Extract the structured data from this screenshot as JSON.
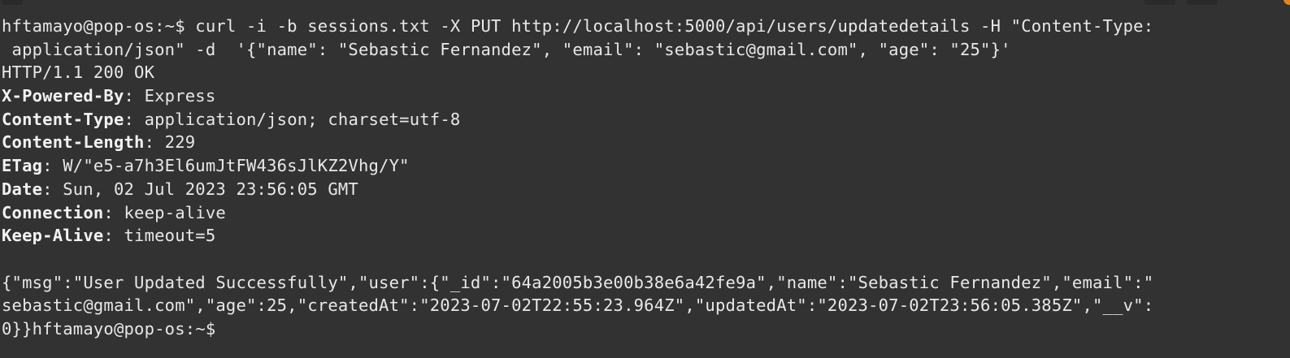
{
  "terminal": {
    "prompt": "hftamayo@pop-os:~$",
    "command_line_1": " curl -i -b sessions.txt -X PUT http://localhost:5000/api/users/updatedetails -H \"Content-Type:",
    "command_line_2": " application/json\" -d  '{\"name\": \"Sebastic Fernandez\", \"email\": \"sebastic@gmail.com\", \"age\": \"25\"}'",
    "status_line": "HTTP/1.1 200 OK",
    "headers": [
      {
        "name": "X-Powered-By",
        "value": ": Express"
      },
      {
        "name": "Content-Type",
        "value": ": application/json; charset=utf-8"
      },
      {
        "name": "Content-Length",
        "value": ": 229"
      },
      {
        "name": "ETag",
        "value": ": W/\"e5-a7h3El6umJtFW436sJlKZ2Vhg/Y\""
      },
      {
        "name": "Date",
        "value": ": Sun, 02 Jul 2023 23:56:05 GMT"
      },
      {
        "name": "Connection",
        "value": ": keep-alive"
      },
      {
        "name": "Keep-Alive",
        "value": ": timeout=5"
      }
    ],
    "body_line_1": "{\"msg\":\"User Updated Successfully\",\"user\":{\"_id\":\"64a2005b3e00b38e6a42fe9a\",\"name\":\"Sebastic Fernandez\",\"email\":\"",
    "body_line_2": "sebastic@gmail.com\",\"age\":25,\"createdAt\":\"2023-07-02T22:55:23.964Z\",\"updatedAt\":\"2023-07-02T23:56:05.385Z\",\"__v\":",
    "body_line_3": "0}}",
    "final_prompt": "hftamayo@pop-os:~$",
    "colors": {
      "background": "#323232",
      "foreground": "#e8e8e8",
      "window_control": "#e0861e"
    }
  }
}
